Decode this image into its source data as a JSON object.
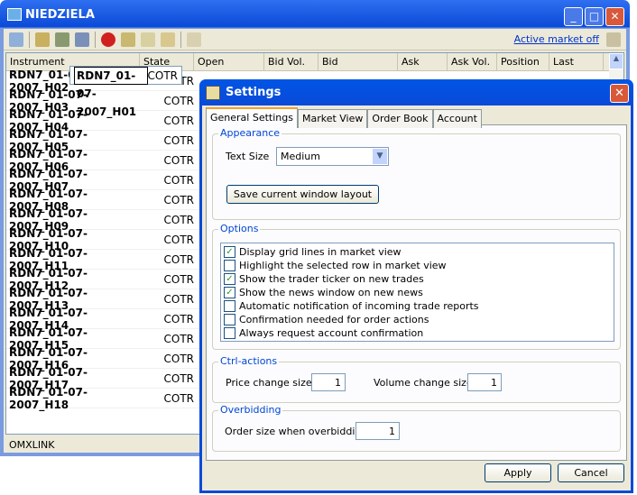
{
  "main_window": {
    "title": "NIEDZIELA",
    "active_market_label": "Active market off",
    "status": "OMXLINK",
    "columns": [
      "Instrument",
      "State",
      "Open",
      "",
      "Bid Vol.",
      "Bid",
      "",
      "Ask",
      "Ask Vol.",
      "Position",
      "Last"
    ],
    "rows": [
      {
        "instrument": "RDN7_01-07-2007_H01",
        "state": "COTR"
      },
      {
        "instrument": "RDN7_01-07-2007_H02",
        "state": "COTR"
      },
      {
        "instrument": "RDN7_01-07-2007_H03",
        "state": "COTR"
      },
      {
        "instrument": "RDN7_01-07-2007_H04",
        "state": "COTR"
      },
      {
        "instrument": "RDN7_01-07-2007_H05",
        "state": "COTR"
      },
      {
        "instrument": "RDN7_01-07-2007_H06",
        "state": "COTR"
      },
      {
        "instrument": "RDN7_01-07-2007_H07",
        "state": "COTR"
      },
      {
        "instrument": "RDN7_01-07-2007_H08",
        "state": "COTR"
      },
      {
        "instrument": "RDN7_01-07-2007_H09",
        "state": "COTR"
      },
      {
        "instrument": "RDN7_01-07-2007_H10",
        "state": "COTR"
      },
      {
        "instrument": "RDN7_01-07-2007_H11",
        "state": "COTR"
      },
      {
        "instrument": "RDN7_01-07-2007_H12",
        "state": "COTR"
      },
      {
        "instrument": "RDN7_01-07-2007_H13",
        "state": "COTR"
      },
      {
        "instrument": "RDN7_01-07-2007_H14",
        "state": "COTR"
      },
      {
        "instrument": "RDN7_01-07-2007_H15",
        "state": "COTR"
      },
      {
        "instrument": "RDN7_01-07-2007_H16",
        "state": "COTR"
      },
      {
        "instrument": "RDN7_01-07-2007_H17",
        "state": "COTR"
      },
      {
        "instrument": "RDN7_01-07-2007_H18",
        "state": "COTR"
      }
    ]
  },
  "settings": {
    "title": "Settings",
    "tabs": [
      "General Settings",
      "Market View",
      "Order Book",
      "Account"
    ],
    "appearance": {
      "legend": "Appearance",
      "text_size_label": "Text Size",
      "text_size_value": "Medium",
      "save_layout_label": "Save current window layout"
    },
    "options": {
      "legend": "Options",
      "items": [
        {
          "label": "Display grid lines in market view",
          "checked": true
        },
        {
          "label": "Highlight the selected row in market view",
          "checked": false
        },
        {
          "label": "Show the trader ticker on new trades",
          "checked": true
        },
        {
          "label": "Show the news window on new news",
          "checked": true
        },
        {
          "label": "Automatic notification of incoming trade reports",
          "checked": false
        },
        {
          "label": "Confirmation needed for order actions",
          "checked": false
        },
        {
          "label": "Always request account confirmation",
          "checked": false
        }
      ]
    },
    "ctrl_actions": {
      "legend": "Ctrl-actions",
      "price_label": "Price change size",
      "price_value": "1",
      "volume_label": "Volume change size",
      "volume_value": "1"
    },
    "overbidding": {
      "legend": "Overbidding",
      "order_size_label": "Order size when overbidding",
      "order_size_value": "1"
    },
    "apply_label": "Apply",
    "cancel_label": "Cancel"
  }
}
